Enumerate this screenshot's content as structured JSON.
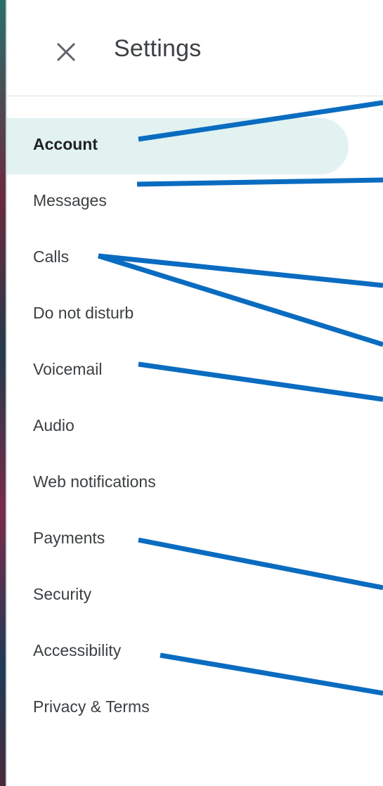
{
  "header": {
    "title": "Settings",
    "close_icon": "close-icon"
  },
  "nav": {
    "items": [
      {
        "label": "Account",
        "active": true
      },
      {
        "label": "Messages"
      },
      {
        "label": "Calls"
      },
      {
        "label": "Do not disturb"
      },
      {
        "label": "Voicemail"
      },
      {
        "label": "Audio"
      },
      {
        "label": "Web notifications"
      },
      {
        "label": "Payments"
      },
      {
        "label": "Security"
      },
      {
        "label": "Accessibility"
      },
      {
        "label": "Privacy & Terms"
      }
    ]
  },
  "colors": {
    "accent_bg": "#e1f2f1",
    "annotation": "#0a6cc0",
    "text": "#3c4043"
  }
}
